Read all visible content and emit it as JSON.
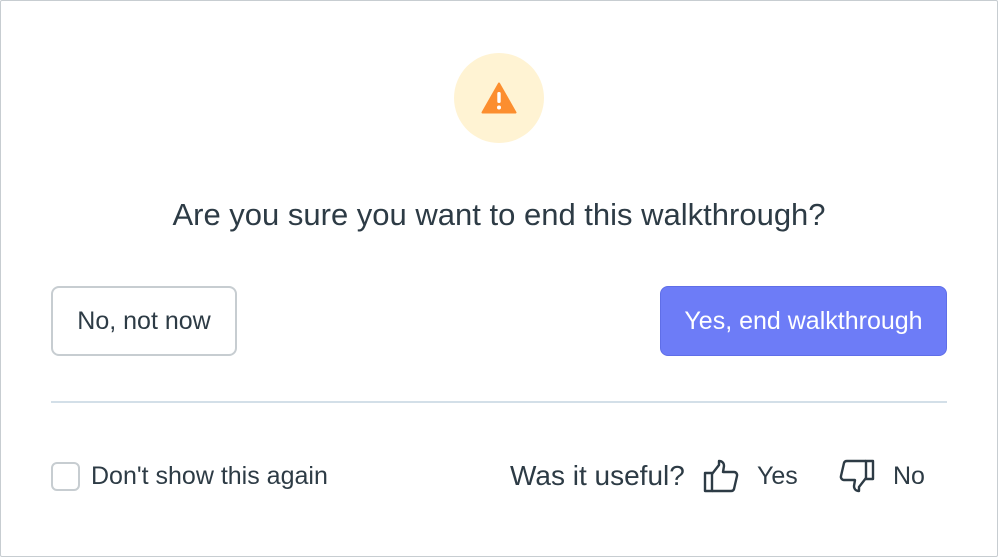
{
  "dialog": {
    "icon": "warning-icon",
    "question": "Are you sure you want to end this walkthrough?",
    "secondary_button": "No, not now",
    "primary_button": "Yes, end walkthrough",
    "dont_show_again": "Don't show this again",
    "dont_show_checked": false,
    "feedback_prompt": "Was it useful?",
    "feedback_yes": "Yes",
    "feedback_no": "No",
    "feedback_yes_icon": "thumbs-up-icon",
    "feedback_no_icon": "thumbs-down-icon"
  },
  "colors": {
    "primary": "#6d7cf7",
    "warning": "#fc8e2f",
    "warning_bg": "#fff3d3",
    "text": "#2d3b45",
    "border": "#c7cdd1"
  }
}
